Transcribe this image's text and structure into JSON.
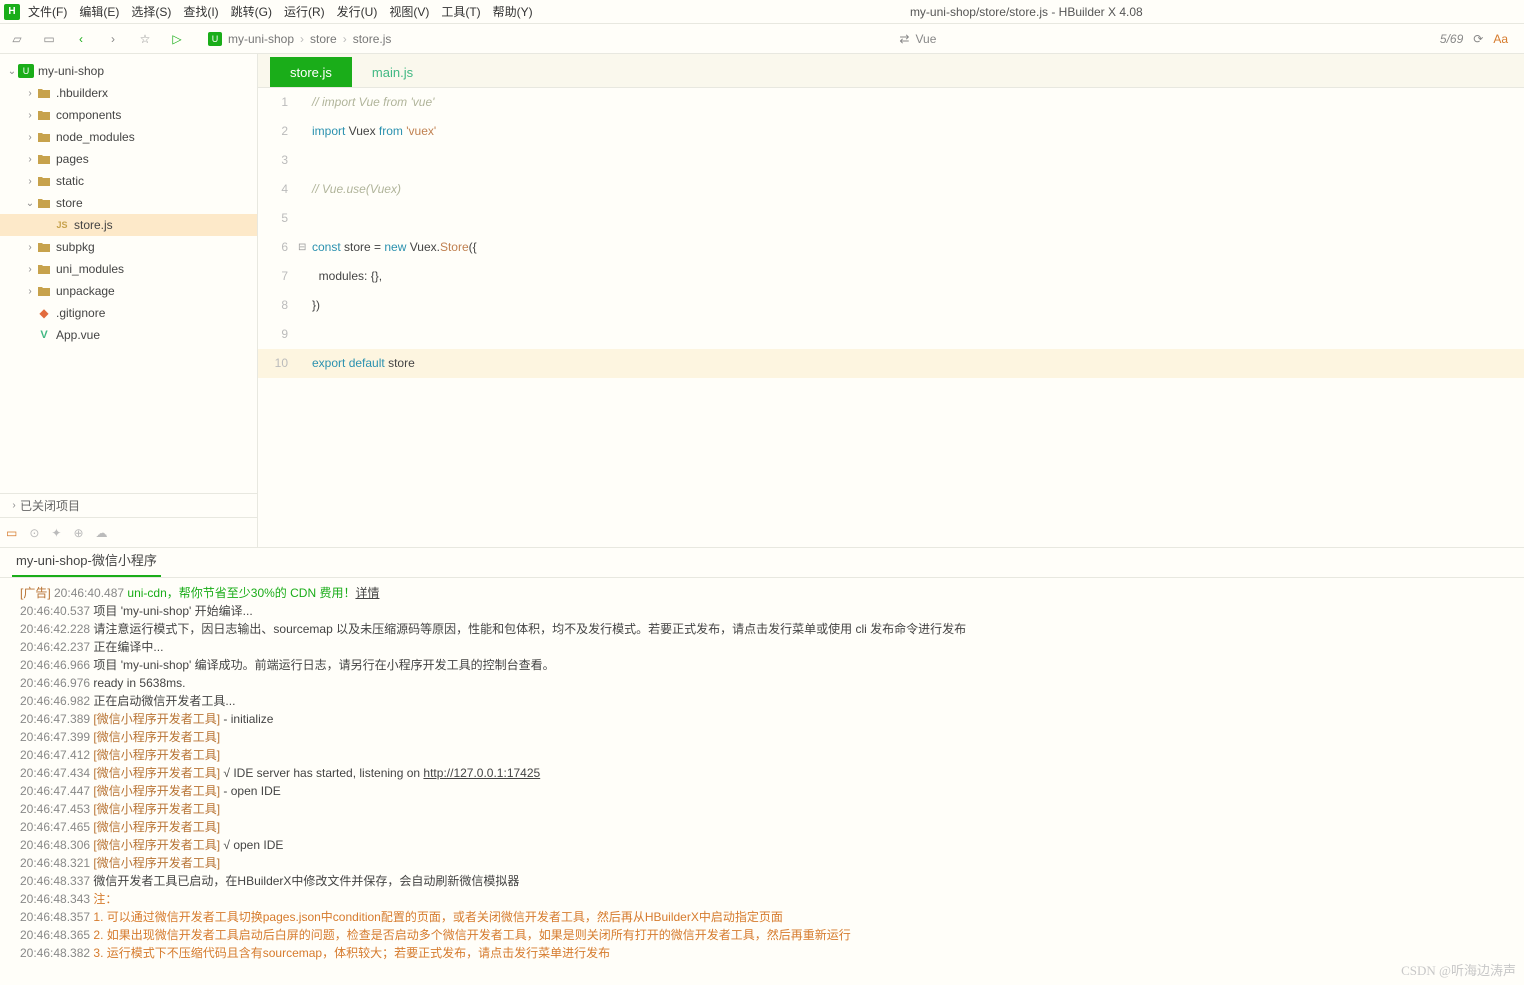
{
  "window_title": "my-uni-shop/store/store.js - HBuilder X 4.08",
  "menu": [
    "文件(F)",
    "编辑(E)",
    "选择(S)",
    "查找(I)",
    "跳转(G)",
    "运行(R)",
    "发行(U)",
    "视图(V)",
    "工具(T)",
    "帮助(Y)"
  ],
  "breadcrumb": [
    "my-uni-shop",
    "store",
    "store.js"
  ],
  "search_placeholder": "Vue",
  "cursor_info": "5/69",
  "sidebar": {
    "project": "my-uni-shop",
    "items": [
      {
        "t": "folder",
        "name": ".hbuilderx",
        "depth": 1,
        "chev": "›"
      },
      {
        "t": "folder",
        "name": "components",
        "depth": 1,
        "chev": "›"
      },
      {
        "t": "folder",
        "name": "node_modules",
        "depth": 1,
        "chev": "›"
      },
      {
        "t": "folder",
        "name": "pages",
        "depth": 1,
        "chev": "›"
      },
      {
        "t": "folder",
        "name": "static",
        "depth": 1,
        "chev": "›"
      },
      {
        "t": "folder-open",
        "name": "store",
        "depth": 1,
        "chev": "⌄"
      },
      {
        "t": "js",
        "name": "store.js",
        "depth": 2,
        "sel": true
      },
      {
        "t": "folder",
        "name": "subpkg",
        "depth": 1,
        "chev": "›"
      },
      {
        "t": "folder",
        "name": "uni_modules",
        "depth": 1,
        "chev": "›"
      },
      {
        "t": "folder",
        "name": "unpackage",
        "depth": 1,
        "chev": "›"
      },
      {
        "t": "git",
        "name": ".gitignore",
        "depth": 1
      },
      {
        "t": "vue",
        "name": "App.vue",
        "depth": 1
      }
    ],
    "closed_projects": "已关闭项目"
  },
  "tabs": [
    {
      "label": "store.js",
      "active": true
    },
    {
      "label": "main.js",
      "active": false
    }
  ],
  "code": [
    {
      "n": 1,
      "fold": "",
      "tokens": [
        {
          "c": "tok-comment",
          "t": "// import Vue from 'vue'"
        }
      ]
    },
    {
      "n": 2,
      "fold": "",
      "tokens": [
        {
          "c": "tok-kw",
          "t": "import"
        },
        {
          "c": "tok-id",
          "t": " Vuex "
        },
        {
          "c": "tok-kw",
          "t": "from"
        },
        {
          "c": "tok-id",
          "t": " "
        },
        {
          "c": "tok-str",
          "t": "'vuex'"
        }
      ]
    },
    {
      "n": 3,
      "fold": "",
      "tokens": [
        {
          "c": "tok-id",
          "t": ""
        }
      ]
    },
    {
      "n": 4,
      "fold": "",
      "tokens": [
        {
          "c": "tok-comment",
          "t": "// Vue.use(Vuex)"
        }
      ]
    },
    {
      "n": 5,
      "fold": "",
      "tokens": [
        {
          "c": "tok-id",
          "t": ""
        }
      ]
    },
    {
      "n": 6,
      "fold": "⊟",
      "tokens": [
        {
          "c": "tok-kw",
          "t": "const"
        },
        {
          "c": "tok-id",
          "t": " store = "
        },
        {
          "c": "tok-kw",
          "t": "new"
        },
        {
          "c": "tok-id",
          "t": " Vuex."
        },
        {
          "c": "tok-fn",
          "t": "Store"
        },
        {
          "c": "tok-id",
          "t": "({"
        }
      ]
    },
    {
      "n": 7,
      "fold": "",
      "tokens": [
        {
          "c": "tok-id",
          "t": "  modules: {},"
        }
      ]
    },
    {
      "n": 8,
      "fold": "",
      "tokens": [
        {
          "c": "tok-id",
          "t": "})"
        }
      ]
    },
    {
      "n": 9,
      "fold": "",
      "tokens": [
        {
          "c": "tok-id",
          "t": ""
        }
      ]
    },
    {
      "n": 10,
      "fold": "",
      "hl": true,
      "tokens": [
        {
          "c": "tok-kw",
          "t": "export"
        },
        {
          "c": "tok-id",
          "t": " "
        },
        {
          "c": "tok-kw",
          "t": "default"
        },
        {
          "c": "tok-id",
          "t": " store"
        }
      ]
    }
  ],
  "console": {
    "tab": "my-uni-shop-微信小程序",
    "lines": [
      {
        "segs": [
          {
            "c": "c-brown",
            "t": "[广告]"
          },
          {
            "c": "c-ts",
            "t": " 20:46:40.487 "
          },
          {
            "c": "c-green",
            "t": "uni-cdn，帮你节省至少30%的 CDN 费用！"
          },
          {
            "c": "c-link",
            "t": "详情"
          }
        ]
      },
      {
        "segs": [
          {
            "c": "c-ts",
            "t": "20:46:40.537 "
          },
          {
            "c": "",
            "t": "项目 'my-uni-shop' 开始编译..."
          }
        ]
      },
      {
        "segs": [
          {
            "c": "c-ts",
            "t": "20:46:42.228 "
          },
          {
            "c": "",
            "t": "请注意运行模式下，因日志输出、sourcemap 以及未压缩源码等原因，性能和包体积，均不及发行模式。若要正式发布，请点击发行菜单或使用 cli 发布命令进行发布"
          }
        ]
      },
      {
        "segs": [
          {
            "c": "c-ts",
            "t": "20:46:42.237 "
          },
          {
            "c": "",
            "t": "正在编译中..."
          }
        ]
      },
      {
        "segs": [
          {
            "c": "c-ts",
            "t": "20:46:46.966 "
          },
          {
            "c": "",
            "t": "项目 'my-uni-shop' 编译成功。前端运行日志，请另行在小程序开发工具的控制台查看。"
          }
        ]
      },
      {
        "segs": [
          {
            "c": "c-ts",
            "t": "20:46:46.976 "
          },
          {
            "c": "",
            "t": "ready in 5638ms."
          }
        ]
      },
      {
        "segs": [
          {
            "c": "c-ts",
            "t": "20:46:46.982 "
          },
          {
            "c": "",
            "t": "正在启动微信开发者工具..."
          }
        ]
      },
      {
        "segs": [
          {
            "c": "c-ts",
            "t": "20:46:47.389 "
          },
          {
            "c": "c-brown",
            "t": "[微信小程序开发者工具]"
          },
          {
            "c": "",
            "t": " - initialize"
          }
        ]
      },
      {
        "segs": [
          {
            "c": "c-ts",
            "t": "20:46:47.399 "
          },
          {
            "c": "c-brown",
            "t": "[微信小程序开发者工具]"
          }
        ]
      },
      {
        "segs": [
          {
            "c": "c-ts",
            "t": "20:46:47.412 "
          },
          {
            "c": "c-brown",
            "t": "[微信小程序开发者工具]"
          }
        ]
      },
      {
        "segs": [
          {
            "c": "c-ts",
            "t": "20:46:47.434 "
          },
          {
            "c": "c-brown",
            "t": "[微信小程序开发者工具]"
          },
          {
            "c": "",
            "t": " √ IDE server has started, listening on "
          },
          {
            "c": "c-link",
            "t": "http://127.0.0.1:17425"
          }
        ]
      },
      {
        "segs": [
          {
            "c": "c-ts",
            "t": "20:46:47.447 "
          },
          {
            "c": "c-brown",
            "t": "[微信小程序开发者工具]"
          },
          {
            "c": "",
            "t": " - open IDE"
          }
        ]
      },
      {
        "segs": [
          {
            "c": "c-ts",
            "t": "20:46:47.453 "
          },
          {
            "c": "c-brown",
            "t": "[微信小程序开发者工具]"
          }
        ]
      },
      {
        "segs": [
          {
            "c": "c-ts",
            "t": "20:46:47.465 "
          },
          {
            "c": "c-brown",
            "t": "[微信小程序开发者工具]"
          }
        ]
      },
      {
        "segs": [
          {
            "c": "c-ts",
            "t": "20:46:48.306 "
          },
          {
            "c": "c-brown",
            "t": "[微信小程序开发者工具]"
          },
          {
            "c": "",
            "t": " √ open IDE"
          }
        ]
      },
      {
        "segs": [
          {
            "c": "c-ts",
            "t": "20:46:48.321 "
          },
          {
            "c": "c-brown",
            "t": "[微信小程序开发者工具]"
          }
        ]
      },
      {
        "segs": [
          {
            "c": "c-ts",
            "t": "20:46:48.337 "
          },
          {
            "c": "",
            "t": "微信开发者工具已启动，在HBuilderX中修改文件并保存，会自动刷新微信模拟器"
          }
        ]
      },
      {
        "segs": [
          {
            "c": "c-ts",
            "t": "20:46:48.343 "
          },
          {
            "c": "c-orange",
            "t": "注："
          }
        ]
      },
      {
        "segs": [
          {
            "c": "c-ts",
            "t": "20:46:48.357 "
          },
          {
            "c": "c-orange",
            "t": "1. 可以通过微信开发者工具切换pages.json中condition配置的页面，或者关闭微信开发者工具，然后再从HBuilderX中启动指定页面"
          }
        ]
      },
      {
        "segs": [
          {
            "c": "c-ts",
            "t": "20:46:48.365 "
          },
          {
            "c": "c-orange",
            "t": "2. 如果出现微信开发者工具启动后白屏的问题，检查是否启动多个微信开发者工具，如果是则关闭所有打开的微信开发者工具，然后再重新运行"
          }
        ]
      },
      {
        "segs": [
          {
            "c": "c-ts",
            "t": "20:46:48.382 "
          },
          {
            "c": "c-orange",
            "t": "3. 运行模式下不压缩代码且含有sourcemap，体积较大；若要正式发布，请点击发行菜单进行发布"
          }
        ]
      }
    ]
  },
  "watermark": "CSDN @听海边涛声"
}
